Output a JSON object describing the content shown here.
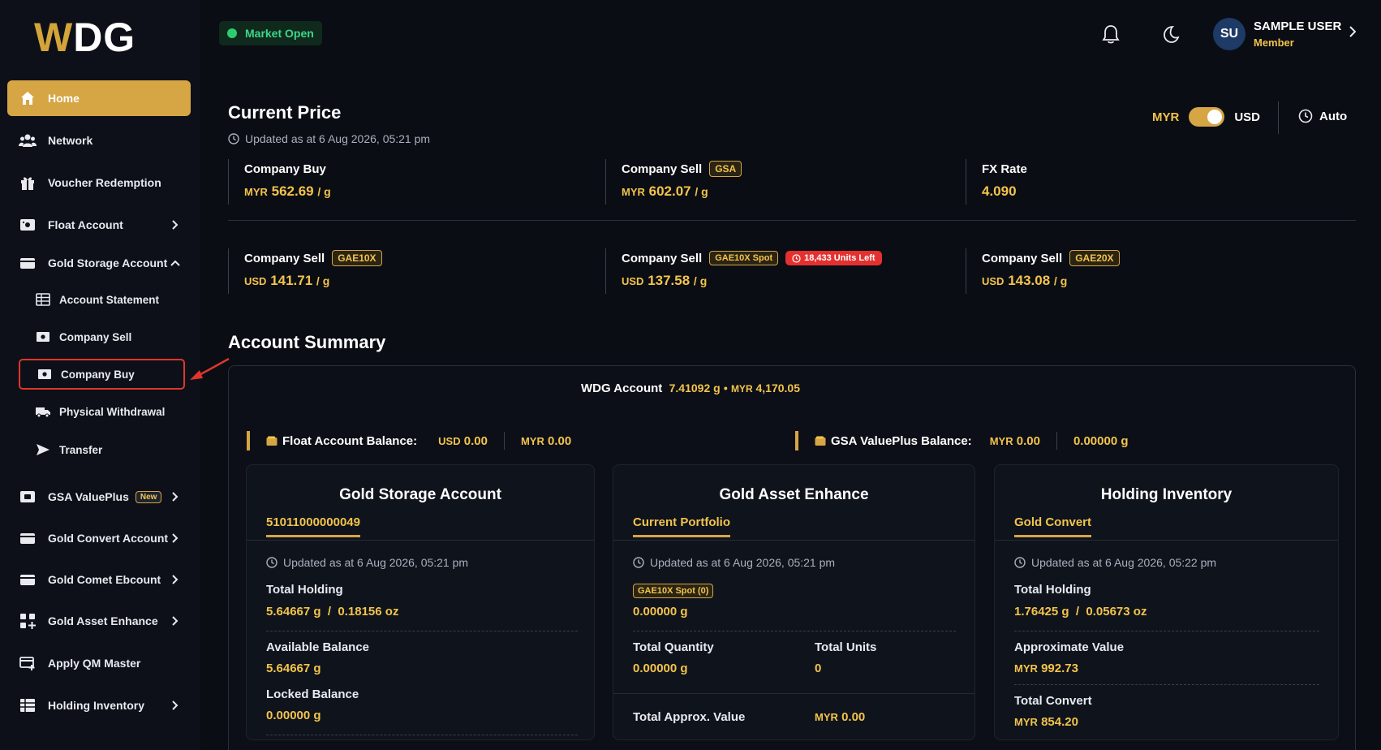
{
  "brand": {
    "logo_text_w": "W",
    "logo_text_rest": "DG"
  },
  "sidebar": {
    "items": [
      {
        "label": "Home",
        "icon": "home-icon"
      },
      {
        "label": "Network",
        "icon": "users-icon"
      },
      {
        "label": "Voucher Redemption",
        "icon": "gift-icon"
      },
      {
        "label": "Float Account",
        "icon": "wallet-icon"
      },
      {
        "label": "Gold Storage Account",
        "icon": "storage-icon"
      },
      {
        "label": "GSA ValuePlus",
        "icon": "valueplus-icon",
        "badge": "New"
      },
      {
        "label": "Gold Convert Account",
        "icon": "convert-icon"
      },
      {
        "label": "Gold Comet Ebcount",
        "icon": "comet-icon"
      },
      {
        "label": "Gold Asset Enhance",
        "icon": "grid-icon"
      },
      {
        "label": "Apply QM Master",
        "icon": "card-icon"
      },
      {
        "label": "Holding Inventory",
        "icon": "table-icon"
      }
    ],
    "sub_items": [
      {
        "label": "Account Statement"
      },
      {
        "label": "Company Sell"
      },
      {
        "label": "Company Buy"
      },
      {
        "label": "Physical Withdrawal"
      },
      {
        "label": "Transfer"
      }
    ]
  },
  "topbar": {
    "market_status": "Market Open",
    "user_initials": "SU",
    "user_name": "SAMPLE USER",
    "user_role": "Member"
  },
  "current_price": {
    "title": "Current Price",
    "updated": "Updated as at 6 Aug 2026, 05:21 pm",
    "toggle_left": "MYR",
    "toggle_right": "USD",
    "auto_label": "Auto",
    "cells": [
      {
        "label": "Company Buy",
        "tag": "",
        "currency": "MYR",
        "value": "562.69",
        "unit": "/ g"
      },
      {
        "label": "Company Sell",
        "tag": "GSA",
        "currency": "MYR",
        "value": "602.07",
        "unit": "/ g"
      },
      {
        "label": "FX Rate",
        "tag": "",
        "currency": "",
        "value": "4.090",
        "unit": ""
      },
      {
        "label": "Company Sell",
        "tag": "GAE10X",
        "currency": "USD",
        "value": "141.71",
        "unit": "/ g"
      },
      {
        "label": "Company Sell",
        "tag": "GAE10X Spot",
        "alert": "18,433 Units Left",
        "currency": "USD",
        "value": "137.58",
        "unit": "/ g"
      },
      {
        "label": "Company Sell",
        "tag": "GAE20X",
        "currency": "USD",
        "value": "143.08",
        "unit": "/ g"
      }
    ]
  },
  "account_summary": {
    "title": "Account Summary",
    "wdg_label": "WDG Account",
    "wdg_grams": "7.41092 g",
    "wdg_dot": "•",
    "wdg_currency": "MYR",
    "wdg_value": "4,170.05",
    "float_label": "Float Account Balance:",
    "float_usd_cur": "USD",
    "float_usd": "0.00",
    "float_myr_cur": "MYR",
    "float_myr": "0.00",
    "gsa_vp_label": "GSA ValuePlus Balance:",
    "gsa_vp_myr_cur": "MYR",
    "gsa_vp_myr": "0.00",
    "gsa_vp_grams": "0.00000 g"
  },
  "cards": {
    "gsa": {
      "title": "Gold Storage Account",
      "tab": "51011000000049",
      "updated": "Updated as at 6 Aug 2026, 05:21 pm",
      "total_holding_label": "Total Holding",
      "total_holding_value": "5.64667 g  /  0.18156 oz",
      "available_label": "Available Balance",
      "available_value": "5.64667 g",
      "locked_label": "Locked Balance",
      "locked_value": "0.00000 g"
    },
    "gae": {
      "title": "Gold Asset Enhance",
      "tab": "Current Portfolio",
      "updated": "Updated as at 6 Aug 2026, 05:21 pm",
      "spot_tag": "GAE10X Spot (0)",
      "spot_value": "0.00000 g",
      "total_qty_label": "Total Quantity",
      "total_qty_value": "0.00000 g",
      "total_units_label": "Total Units",
      "total_units_value": "0",
      "approx_label": "Total Approx. Value",
      "approx_currency": "MYR",
      "approx_value": "0.00"
    },
    "hi": {
      "title": "Holding Inventory",
      "tab": "Gold Convert",
      "updated": "Updated as at 6 Aug 2026, 05:22 pm",
      "total_holding_label": "Total Holding",
      "total_holding_value": "1.76425 g  /  0.05673 oz",
      "approx_label": "Approximate Value",
      "approx_currency": "MYR",
      "approx_value": "992.73",
      "convert_label": "Total Convert",
      "convert_currency": "MYR",
      "convert_value": "854.20"
    }
  },
  "colors": {
    "accent": "#d6a544",
    "gold_text": "#f3c44b",
    "background": "#0a0d14",
    "market_green": "#2ecc71",
    "alert_red": "#e53030"
  }
}
